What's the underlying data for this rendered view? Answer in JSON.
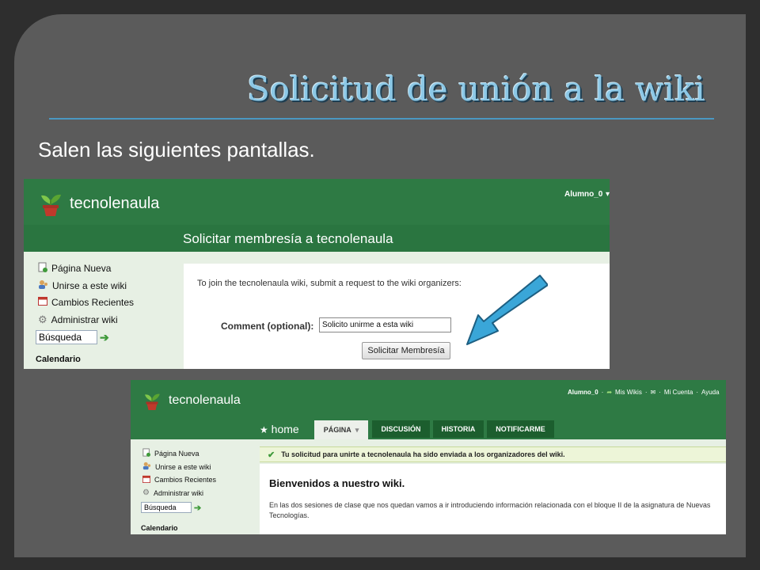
{
  "slide": {
    "title": "Solicitud de unión a la wiki",
    "subtitle": "Salen las siguientes pantallas."
  },
  "shot1": {
    "site_name": "tecnolenaula",
    "user": "Alumno_0",
    "page_heading": "Solicitar membresía a tecnolenaula",
    "sidebar": {
      "items": [
        {
          "label": "Página Nueva",
          "icon": "new-page-icon"
        },
        {
          "label": "Unirse a este wiki",
          "icon": "join-users-icon"
        },
        {
          "label": "Cambios Recientes",
          "icon": "calendar-icon"
        },
        {
          "label": "Administrar wiki",
          "icon": "gear-icon"
        }
      ],
      "search_value": "Búsqueda",
      "calendar_label": "Calendario"
    },
    "form": {
      "intro": "To join the tecnolenaula wiki, submit a request to the wiki organizers:",
      "comment_label": "Comment (optional):",
      "comment_value": "Solicito unirme a esta wiki",
      "submit_label": "Solicitar Membresía"
    },
    "arrow_color": "#3aa6d8"
  },
  "shot2": {
    "site_name": "tecnolenaula",
    "user_links": {
      "user": "Alumno_0",
      "wikis": "Mis Wikis",
      "account": "Mi Cuenta",
      "help": "Ayuda"
    },
    "home_label": "home",
    "tabs": [
      {
        "label": "PÁGINA",
        "active": true
      },
      {
        "label": "DISCUSIÓN",
        "active": false
      },
      {
        "label": "HISTORIA",
        "active": false
      },
      {
        "label": "NOTIFICARME",
        "active": false
      }
    ],
    "sidebar": {
      "items": [
        {
          "label": "Página Nueva",
          "icon": "new-page-icon"
        },
        {
          "label": "Unirse a este wiki",
          "icon": "join-users-icon"
        },
        {
          "label": "Cambios Recientes",
          "icon": "calendar-icon"
        },
        {
          "label": "Administrar wiki",
          "icon": "gear-icon"
        }
      ],
      "search_value": "Búsqueda",
      "calendar_label": "Calendario"
    },
    "notice": "Tu solicitud para unirte a tecnolenaula ha sido enviada a los organizadores del wiki.",
    "welcome": "Bienvenidos a nuestro wiki.",
    "intro_text": "En las dos sesiones de clase que nos quedan vamos a ir introduciendo información relacionada con el bloque II de la asignatura de Nuevas Tecnologías."
  },
  "colors": {
    "header_green": "#2e7a44",
    "sidebar_bg": "#e7f0e4",
    "title_blue": "#8cc8e6",
    "slide_bg": "#5b5b5b"
  }
}
